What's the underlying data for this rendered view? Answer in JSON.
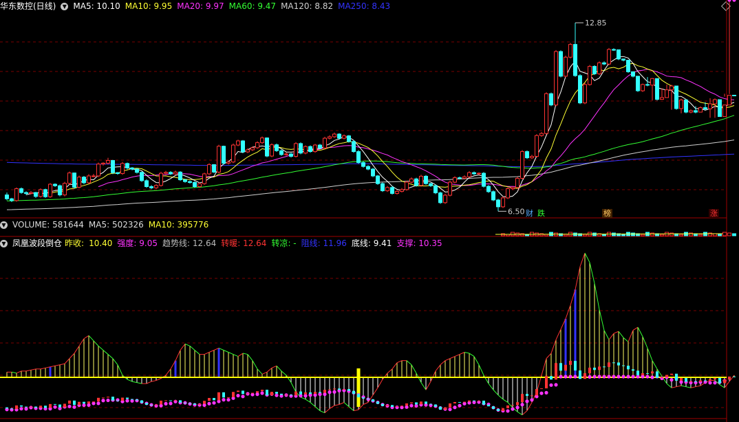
{
  "main_header": {
    "stock_title": "华东数控(日线)",
    "items": [
      {
        "label": "MA5: 10.10",
        "color": "#ffffff"
      },
      {
        "label": "MA10: 9.95",
        "color": "#ffff33"
      },
      {
        "label": "MA20: 9.97",
        "color": "#ff33ff"
      },
      {
        "label": "MA60: 9.47",
        "color": "#33ff33"
      },
      {
        "label": "MA120: 8.82",
        "color": "#d0d0d0"
      },
      {
        "label": "MA250: 8.43",
        "color": "#3333ff"
      }
    ]
  },
  "price_annotations": {
    "high": "12.85",
    "low": "6.50"
  },
  "event_tags": [
    {
      "text": "财",
      "color": "#55aaff"
    },
    {
      "text": "跌",
      "color": "#33ff33"
    },
    {
      "text": "榜",
      "color": "#ffcc66"
    },
    {
      "text": "涨",
      "color": "#ff3333"
    }
  ],
  "volume_header": {
    "items": [
      {
        "label": "VOLUME: 581644",
        "color": "#dddddd"
      },
      {
        "label": "MA5: 502326",
        "color": "#dddddd"
      },
      {
        "label": "MA10: 395776",
        "color": "#ffff33"
      }
    ]
  },
  "indicator_header": {
    "name": "凤凰波段倒仓",
    "items": [
      {
        "label": "昨收:",
        "color": "#ffff33"
      },
      {
        "label": "10.40",
        "color": "#ffff33"
      },
      {
        "label": "强度: 9.05",
        "color": "#ff33ff"
      },
      {
        "label": "趋势线: 12.64",
        "color": "#bbbbbb"
      },
      {
        "label": "转暖: 12.64",
        "color": "#ff3333"
      },
      {
        "label": "转凉: -",
        "color": "#33ff33"
      },
      {
        "label": "阻线: 11.96",
        "color": "#3333ff"
      },
      {
        "label": "底线: 9.41",
        "color": "#ffffff"
      },
      {
        "label": "支撑: 10.35",
        "color": "#ff33ff"
      }
    ]
  },
  "colors": {
    "up": "#ff3333",
    "down": "#33ffff",
    "grid": "#7a0000",
    "ma5": "#ffffff",
    "ma10": "#ffff33",
    "ma20": "#ff33ff",
    "ma60": "#33ff33",
    "ma120": "#d0d0d0",
    "ma250": "#3333ff"
  },
  "chart_data": {
    "type": "line",
    "candles": {
      "open": [
        7.05,
        6.92,
        6.86,
        7.26,
        7.13,
        7.1,
        7.13,
        7.0,
        7.23,
        6.99,
        7.41,
        7.36,
        7.05,
        7.44,
        7.79,
        7.31,
        7.65,
        7.46,
        7.69,
        7.69,
        8.09,
        8.12,
        8.21,
        7.8,
        7.77,
        8.11,
        7.96,
        7.92,
        7.81,
        7.53,
        7.33,
        7.29,
        7.37,
        7.78,
        7.81,
        7.76,
        7.82,
        7.56,
        7.5,
        7.47,
        7.33,
        7.43,
        7.76,
        8.07,
        7.82,
        8.69,
        8.12,
        8.16,
        8.73,
        8.87,
        8.5,
        8.57,
        8.64,
        8.81,
        8.97,
        8.36,
        8.74,
        8.54,
        8.41,
        8.43,
        8.35,
        8.78,
        8.46,
        8.68,
        8.51,
        8.73,
        8.63,
        8.96,
        9.01,
        9.1,
        8.96,
        9.04,
        8.85,
        8.51,
        8.14,
        8.01,
        7.92,
        7.69,
        7.43,
        7.19,
        7.3,
        7.1,
        7.17,
        7.23,
        7.48,
        7.59,
        7.37,
        7.68,
        7.43,
        7.36,
        7.12,
        6.79,
        7.04,
        7.48,
        7.63,
        7.61,
        7.66,
        7.8,
        7.76,
        7.78,
        7.34,
        7.16,
        6.88,
        6.65,
        6.95,
        7.26,
        7.3,
        7.61,
        8.51,
        8.3,
        8.35,
        9.05,
        9.12,
        10.46,
        10.08,
        11.88,
        11.05,
        11.69,
        12.12,
        11.07,
        10.15,
        10.77,
        11.38,
        11.13,
        11.5,
        11.46,
        11.95,
        11.94,
        11.63,
        11.59,
        11.2,
        11.05,
        10.56,
        10.77,
        10.75,
        10.97,
        10.27,
        10.33,
        10.59,
        10.72,
        9.96,
        10.25,
        9.84,
        9.89,
        9.84,
        9.99,
        9.95,
        10.12,
        10.26,
        9.69,
        10.08,
        10.41
      ],
      "close": [
        6.92,
        6.86,
        7.26,
        7.13,
        7.1,
        7.13,
        7.0,
        7.23,
        6.99,
        7.41,
        7.36,
        7.05,
        7.44,
        7.79,
        7.31,
        7.65,
        7.46,
        7.69,
        7.69,
        8.09,
        8.12,
        8.21,
        7.8,
        7.77,
        8.11,
        7.96,
        7.92,
        7.81,
        7.53,
        7.33,
        7.29,
        7.37,
        7.78,
        7.81,
        7.76,
        7.82,
        7.56,
        7.5,
        7.47,
        7.33,
        7.43,
        7.76,
        8.07,
        7.82,
        8.69,
        8.12,
        8.16,
        8.73,
        8.87,
        8.5,
        8.57,
        8.64,
        8.81,
        8.97,
        8.36,
        8.74,
        8.54,
        8.41,
        8.43,
        8.35,
        8.78,
        8.46,
        8.68,
        8.51,
        8.73,
        8.63,
        8.96,
        9.01,
        9.1,
        8.96,
        9.04,
        8.85,
        8.51,
        8.14,
        8.01,
        7.92,
        7.69,
        7.43,
        7.19,
        7.3,
        7.1,
        7.17,
        7.23,
        7.48,
        7.59,
        7.37,
        7.68,
        7.43,
        7.36,
        7.12,
        6.79,
        7.04,
        7.48,
        7.63,
        7.61,
        7.66,
        7.8,
        7.76,
        7.78,
        7.34,
        7.16,
        6.88,
        6.65,
        6.95,
        7.26,
        7.3,
        7.61,
        8.51,
        8.3,
        8.35,
        9.05,
        9.12,
        10.46,
        10.08,
        11.88,
        11.05,
        11.69,
        12.12,
        11.07,
        10.15,
        10.77,
        11.38,
        11.13,
        11.5,
        11.46,
        11.95,
        11.94,
        11.63,
        11.59,
        11.2,
        11.05,
        10.56,
        10.77,
        10.75,
        10.97,
        10.27,
        10.33,
        10.59,
        10.72,
        9.96,
        10.25,
        9.84,
        9.89,
        9.84,
        9.99,
        9.95,
        10.12,
        10.26,
        9.69,
        10.08,
        10.41,
        10.4
      ],
      "high": [
        7.13,
        6.95,
        7.3,
        7.3,
        7.17,
        7.18,
        7.15,
        7.27,
        7.26,
        7.45,
        7.44,
        7.4,
        7.49,
        7.84,
        7.8,
        7.7,
        7.69,
        7.75,
        7.76,
        8.14,
        8.15,
        8.3,
        8.23,
        7.82,
        8.16,
        8.14,
        7.99,
        7.95,
        7.84,
        7.58,
        7.38,
        7.41,
        7.83,
        7.86,
        7.85,
        7.87,
        7.85,
        7.59,
        7.54,
        7.51,
        7.47,
        7.8,
        8.12,
        8.09,
        8.74,
        8.71,
        8.21,
        8.78,
        8.91,
        8.9,
        8.62,
        8.68,
        8.86,
        9.02,
        8.99,
        8.79,
        8.78,
        8.58,
        8.48,
        8.47,
        8.83,
        8.82,
        8.72,
        8.72,
        8.77,
        8.77,
        9.01,
        9.06,
        9.15,
        9.13,
        9.09,
        9.07,
        8.89,
        8.56,
        8.19,
        8.05,
        7.96,
        7.72,
        7.47,
        7.35,
        7.35,
        7.21,
        7.28,
        7.53,
        7.64,
        7.63,
        7.73,
        7.72,
        7.46,
        7.4,
        7.16,
        7.09,
        7.53,
        7.68,
        7.67,
        7.71,
        7.85,
        7.84,
        7.81,
        7.82,
        7.38,
        7.2,
        6.92,
        7.0,
        7.3,
        7.34,
        7.66,
        8.56,
        8.55,
        8.4,
        9.1,
        9.17,
        10.51,
        10.5,
        11.93,
        11.92,
        11.74,
        12.17,
        12.85,
        11.12,
        10.82,
        11.43,
        11.42,
        11.55,
        11.55,
        12.0,
        11.99,
        11.68,
        11.64,
        11.25,
        11.1,
        10.82,
        10.8,
        11.02,
        10.99,
        10.38,
        10.64,
        10.77,
        10.76,
        10.3,
        10.29,
        9.93,
        9.93,
        10.04,
        10.03,
        10.17,
        10.31,
        10.3,
        10.13,
        10.46,
        10.45
      ],
      "low": [
        6.87,
        6.81,
        6.82,
        7.09,
        7.05,
        7.06,
        6.95,
        6.96,
        6.95,
        6.95,
        7.32,
        7.0,
        7.0,
        7.4,
        7.26,
        7.27,
        7.41,
        7.42,
        7.65,
        7.65,
        8.04,
        8.08,
        7.75,
        7.73,
        7.73,
        7.91,
        7.88,
        7.77,
        7.49,
        7.29,
        7.24,
        7.25,
        7.33,
        7.74,
        7.72,
        7.72,
        7.52,
        7.46,
        7.43,
        7.29,
        7.29,
        7.39,
        7.72,
        7.78,
        7.78,
        8.08,
        8.07,
        8.12,
        8.69,
        8.46,
        8.46,
        8.53,
        8.6,
        8.77,
        8.32,
        8.32,
        8.5,
        8.37,
        8.37,
        8.31,
        8.31,
        8.42,
        8.42,
        8.47,
        8.47,
        8.59,
        8.59,
        8.92,
        8.97,
        8.92,
        8.92,
        8.81,
        8.47,
        8.1,
        7.97,
        7.88,
        7.65,
        7.39,
        7.15,
        7.15,
        7.06,
        7.06,
        7.13,
        7.19,
        7.44,
        7.33,
        7.33,
        7.39,
        7.32,
        7.08,
        6.75,
        6.75,
        7.0,
        7.44,
        7.57,
        7.57,
        7.62,
        7.72,
        7.72,
        7.3,
        7.12,
        6.84,
        6.5,
        6.61,
        6.91,
        7.22,
        7.26,
        7.57,
        8.26,
        8.26,
        8.31,
        9.01,
        9.08,
        10.04,
        10.04,
        11.01,
        11.01,
        11.65,
        11.03,
        10.11,
        10.11,
        10.73,
        11.09,
        11.09,
        11.42,
        11.42,
        11.9,
        11.59,
        11.55,
        11.16,
        11.01,
        10.52,
        10.52,
        10.71,
        10.23,
        10.23,
        10.29,
        10.55,
        9.92,
        9.92,
        9.8,
        9.8,
        9.8,
        9.8,
        9.91,
        9.91,
        9.65,
        9.65,
        10.04,
        10.36
      ]
    },
    "ylim": [
      6.3,
      13.2
    ],
    "ind": [
      0.5,
      0.5,
      0.4,
      0.6,
      0.6,
      0.7,
      0.8,
      0.8,
      0.9,
      1.0,
      1.1,
      1.2,
      1.3,
      1.8,
      2.3,
      3.0,
      3.7,
      4.0,
      3.5,
      3.0,
      2.6,
      2.2,
      1.8,
      1.2,
      0.2,
      -0.2,
      -0.4,
      -0.5,
      -0.6,
      -0.6,
      -0.4,
      -0.3,
      -0.1,
      0.2,
      0.8,
      1.6,
      2.6,
      3.2,
      3.0,
      2.6,
      2.2,
      2.2,
      2.4,
      2.6,
      2.8,
      2.6,
      2.4,
      2.2,
      2.0,
      2.3,
      2.2,
      1.6,
      0.8,
      0.3,
      0.5,
      0.9,
      1.1,
      0.6,
      0.2,
      -0.5,
      -1.4,
      -1.9,
      -2.1,
      -2.4,
      -2.8,
      -3.2,
      -3.4,
      -3.0,
      -2.7,
      -2.6,
      -2.4,
      -2.8,
      -3.2,
      -3.1,
      -2.6,
      -2.4,
      -1.7,
      -1.0,
      -0.2,
      0.4,
      0.8,
      1.4,
      1.6,
      1.6,
      1.2,
      0.4,
      -0.5,
      -1.2,
      -0.4,
      0.6,
      1.2,
      1.6,
      1.8,
      2.0,
      2.2,
      2.4,
      2.3,
      2.0,
      1.2,
      0.2,
      -0.6,
      -1.2,
      -1.7,
      -2.1,
      -2.4,
      -2.9,
      -3.3,
      -3.6,
      -3.2,
      -2.4,
      -1.4,
      0.2,
      1.8,
      2.3,
      3.6,
      4.6,
      5.6,
      6.9,
      8.4,
      10.6,
      11.9,
      11.0,
      9.0,
      6.5,
      4.5,
      3.6,
      4.2,
      4.4,
      3.8,
      3.4,
      4.5,
      4.8,
      3.9,
      2.8,
      1.6,
      0.8,
      0.1,
      -0.6,
      -1.0,
      -0.9,
      -0.8,
      -0.9,
      -1.0,
      -0.9,
      -0.8,
      -0.5,
      -0.3,
      -0.3,
      -0.7,
      -1.0,
      -0.4,
      0.2,
      1.5,
      1.9
    ],
    "ind_markers": [
      118,
      73,
      37
    ]
  }
}
